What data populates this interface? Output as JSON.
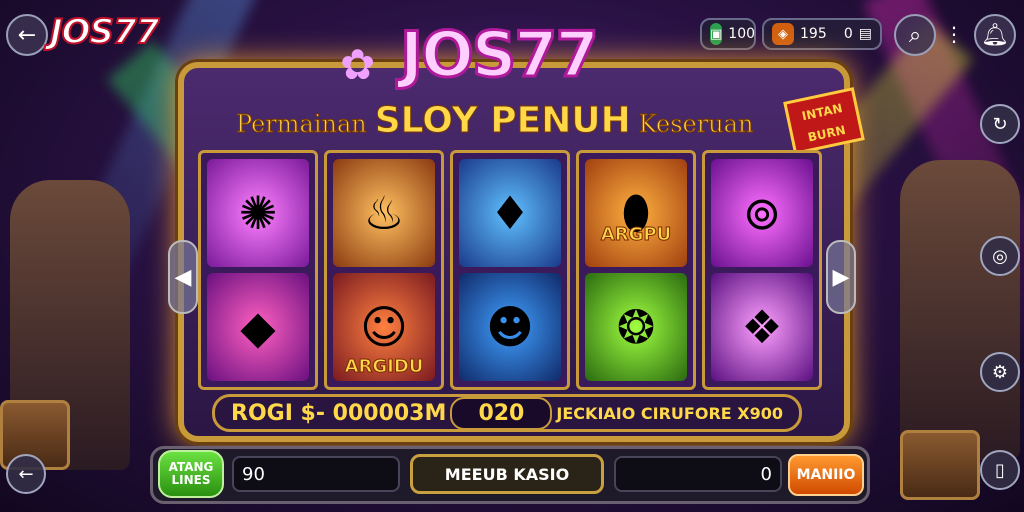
{
  "header": {
    "logo": "JOS77",
    "balance_a": "100",
    "balance_b": "195",
    "balance_c": "0"
  },
  "game": {
    "title": "JOS77",
    "subtitle_1": "Permainan",
    "subtitle_2": "SLOY PENUH",
    "subtitle_3": "Keseruan",
    "badge": "INTAN BURN",
    "reel_labels": [
      "ARGPU",
      "ARGIDU"
    ],
    "info_left": "ROGI $- 000003M",
    "info_mid": "020",
    "info_right": "JECKIAIO CIRUFORE X900"
  },
  "controls": {
    "auto_label": "ATANG LINES",
    "bet_value": "90",
    "mid_label": "MEEUB KASIO",
    "win_value": "0",
    "spin_label": "MANIIO"
  },
  "colors": {
    "gold": "#c89a3a",
    "accent": "#ffd84a",
    "purple": "#4b2a6e",
    "green": "#4ac020",
    "orange": "#ff7a10"
  }
}
